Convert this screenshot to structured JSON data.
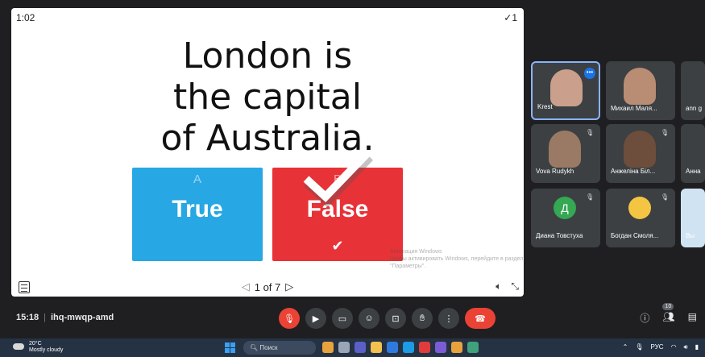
{
  "presentation": {
    "timer": "1:02",
    "answered_count": "✓1",
    "question_lines": [
      "London is",
      "the capital",
      "of Australia."
    ],
    "answers": [
      {
        "letter": "A",
        "text": "True",
        "color": "#27a7e3"
      },
      {
        "letter": "B",
        "text": "False",
        "color": "#e73237",
        "correct_mark": "✔"
      }
    ],
    "watermark_title": "Активация Windows",
    "watermark_text": "Чтобы активировать Windows, перейдите в раздел \"Параметры\".",
    "page_indicator": "1 of 7",
    "prev_icon": "◁",
    "next_icon": "▷"
  },
  "participants": [
    {
      "name": "Krest",
      "kind": "video",
      "active": true
    },
    {
      "name": "Михаил Маля...",
      "kind": "video"
    },
    {
      "name": "ann g",
      "kind": "video"
    },
    {
      "name": "Vova Rudykh",
      "kind": "video",
      "muted": true
    },
    {
      "name": "Анжеліна Біл...",
      "kind": "video",
      "muted": true
    },
    {
      "name": "Анна",
      "kind": "video"
    },
    {
      "name": "Диана Товстуха",
      "kind": "letter",
      "letter": "Д",
      "muted": true
    },
    {
      "name": "Богдан Смоля...",
      "kind": "photo",
      "muted": true
    },
    {
      "name": "Вы",
      "kind": "video"
    }
  ],
  "meeting": {
    "time": "15:18",
    "code": "ihq-mwqp-amd",
    "people_count": "10"
  },
  "taskbar": {
    "temperature": "20°C",
    "weather": "Mostly cloudy",
    "search_label": "Поиск",
    "language": "РУС",
    "colors": {
      "start": "#3aa0f3",
      "bar": "#253244"
    }
  }
}
